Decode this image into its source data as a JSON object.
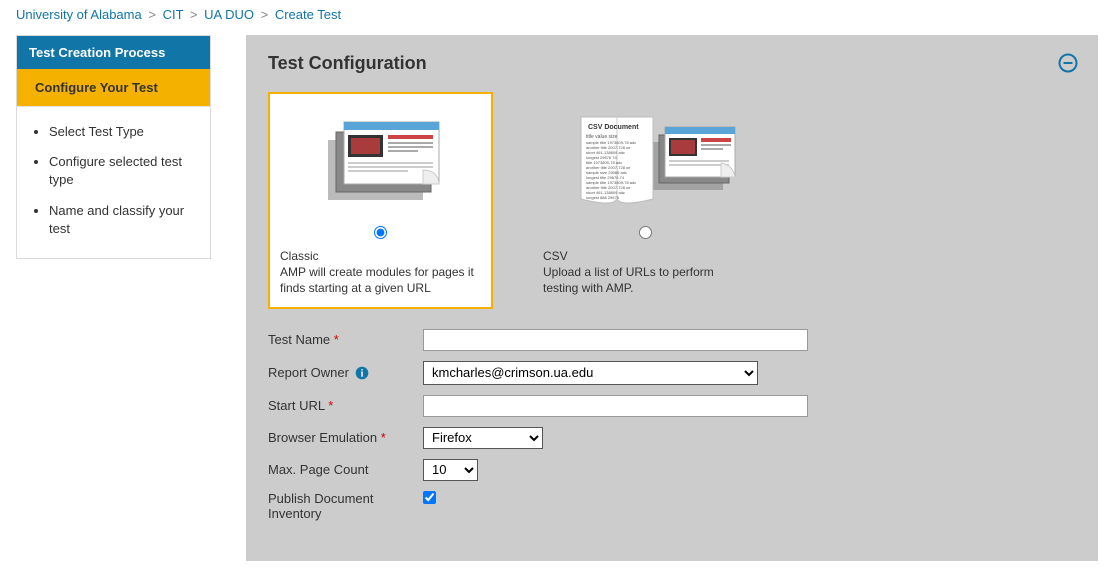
{
  "breadcrumb": {
    "items": [
      "University of Alabama",
      "CIT",
      "UA DUO"
    ],
    "current": "Create Test"
  },
  "sidebar": {
    "header": "Test Creation Process",
    "active": "Configure Your Test",
    "steps": [
      "Select Test Type",
      "Configure selected test type",
      "Name and classify your test"
    ]
  },
  "main": {
    "title": "Test Configuration",
    "types": {
      "classic": {
        "title": "Classic",
        "desc": "AMP will create modules for pages it finds starting at a given URL"
      },
      "csv": {
        "title": "CSV",
        "desc": "Upload a list of URLs to perform testing with AMP."
      },
      "selected": "classic"
    },
    "form": {
      "test_name": {
        "label": "Test Name",
        "value": ""
      },
      "report_owner": {
        "label": "Report Owner",
        "value": "kmcharles@crimson.ua.edu"
      },
      "start_url": {
        "label": "Start URL",
        "value": ""
      },
      "browser_emulation": {
        "label": "Browser Emulation",
        "value": "Firefox"
      },
      "max_page_count": {
        "label": "Max. Page Count",
        "value": "10"
      },
      "publish_doc_inventory": {
        "label": "Publish Document Inventory",
        "checked": true
      }
    }
  }
}
